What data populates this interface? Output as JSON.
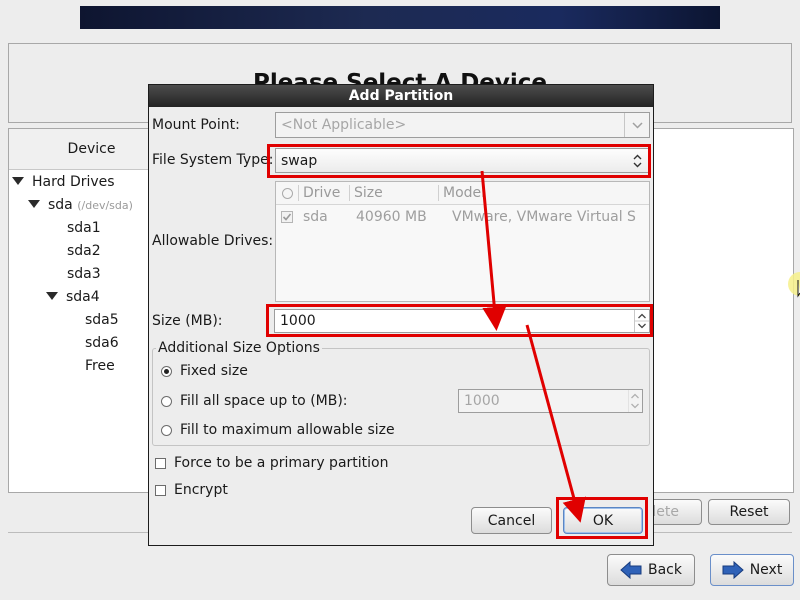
{
  "background": {
    "page_title": "Please Select A Device",
    "tree": {
      "header": "Device",
      "items": [
        {
          "label": "Hard Drives",
          "sub": "",
          "expanded": true
        },
        {
          "label": "sda",
          "sub": "(/dev/sda)",
          "expanded": true
        },
        {
          "label": "sda1",
          "sub": ""
        },
        {
          "label": "sda2",
          "sub": ""
        },
        {
          "label": "sda3",
          "sub": ""
        },
        {
          "label": "sda4",
          "sub": "",
          "expanded": true
        },
        {
          "label": "sda5",
          "sub": ""
        },
        {
          "label": "sda6",
          "sub": ""
        },
        {
          "label": "Free",
          "sub": ""
        }
      ]
    },
    "buttons": {
      "delete": "lete",
      "reset": "Reset",
      "back": "Back",
      "next": "Next"
    }
  },
  "dialog": {
    "title": "Add Partition",
    "mount_point": {
      "label": "Mount Point:",
      "value": "<Not Applicable>"
    },
    "fs_type": {
      "label": "File System Type:",
      "value": "swap"
    },
    "allowable_drives": {
      "label": "Allowable Drives:",
      "columns": [
        "Drive",
        "Size",
        "Model"
      ],
      "rows": [
        {
          "checked": true,
          "drive": "sda",
          "size": "40960 MB",
          "model": "VMware, VMware Virtual S"
        }
      ]
    },
    "size": {
      "label": "Size (MB):",
      "value": "1000"
    },
    "additional": {
      "legend": "Additional Size Options",
      "options": [
        "Fixed size",
        "Fill all space up to (MB):",
        "Fill to maximum allowable size"
      ],
      "selected": 0,
      "fill_value": "1000"
    },
    "force_primary": {
      "label": "Force to be a primary partition",
      "checked": false
    },
    "encrypt": {
      "label": "Encrypt",
      "checked": false
    },
    "cancel": "Cancel",
    "ok": "OK"
  },
  "colors": {
    "highlight": "#e00000",
    "arrow": "#e00000",
    "banner": "#1a2550"
  }
}
